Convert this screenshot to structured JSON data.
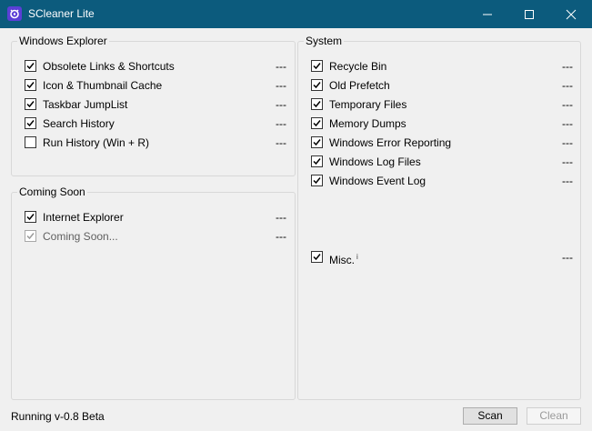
{
  "window": {
    "title": "SCleaner Lite"
  },
  "colors": {
    "titlebar": "#0c5b7d",
    "icon": "#5b3fd6"
  },
  "groups": {
    "explorer": {
      "title": "Windows Explorer",
      "items": [
        {
          "label": "Obsolete Links & Shortcuts",
          "value": "---",
          "checked": true
        },
        {
          "label": "Icon & Thumbnail Cache",
          "value": "---",
          "checked": true
        },
        {
          "label": "Taskbar JumpList",
          "value": "---",
          "checked": true
        },
        {
          "label": "Search History",
          "value": "---",
          "checked": true
        },
        {
          "label": "Run History (Win + R)",
          "value": "---",
          "checked": false
        }
      ]
    },
    "coming": {
      "title": "Coming Soon",
      "items": [
        {
          "label": "Internet Explorer",
          "value": "---",
          "checked": true
        },
        {
          "label": "Coming Soon...",
          "value": "---",
          "checked": true,
          "disabled": true
        }
      ]
    },
    "system": {
      "title": "System",
      "items": [
        {
          "label": "Recycle Bin",
          "value": "---",
          "checked": true
        },
        {
          "label": "Old Prefetch",
          "value": "---",
          "checked": true
        },
        {
          "label": "Temporary Files",
          "value": "---",
          "checked": true
        },
        {
          "label": "Memory Dumps",
          "value": "---",
          "checked": true
        },
        {
          "label": "Windows Error Reporting",
          "value": "---",
          "checked": true
        },
        {
          "label": "Windows Log Files",
          "value": "---",
          "checked": true
        },
        {
          "label": "Windows Event Log",
          "value": "---",
          "checked": true
        }
      ],
      "misc": {
        "label": "Misc.",
        "info": "i",
        "value": "---",
        "checked": true
      }
    }
  },
  "status": "Running v-0.8 Beta",
  "buttons": {
    "scan": "Scan",
    "clean": "Clean"
  }
}
